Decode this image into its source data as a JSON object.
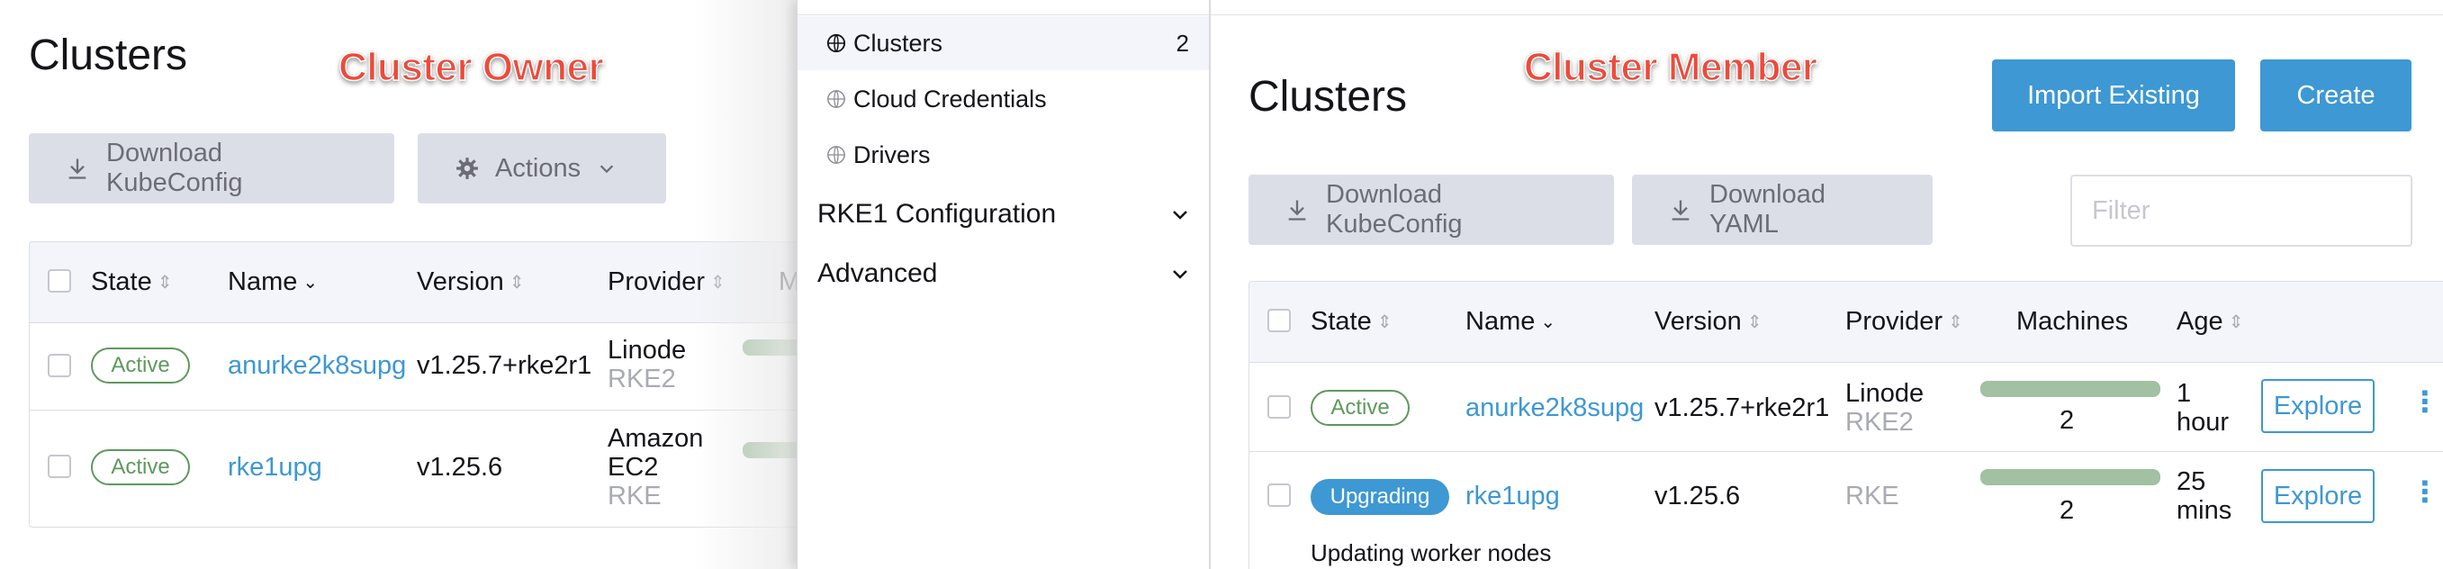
{
  "owner": {
    "title": "Clusters",
    "callout": "Cluster Owner",
    "download_kubeconfig": "Download KubeConfig",
    "actions": "Actions",
    "columns": [
      "State",
      "Name",
      "Version",
      "Provider",
      "M"
    ],
    "rows": [
      {
        "state": "Active",
        "name": "anurke2k8supg",
        "version": "v1.25.7+rke2r1",
        "provider": "Linode",
        "provider_sub": "RKE2"
      },
      {
        "state": "Active",
        "name": "rke1upg",
        "version": "v1.25.6",
        "provider": "Amazon",
        "provider_line2": "EC2",
        "provider_sub": "RKE"
      }
    ]
  },
  "nav": {
    "items": [
      {
        "label": "Clusters",
        "count": "2",
        "icon": "globe-icon"
      },
      {
        "label": "Cloud Credentials",
        "icon": "globe-icon"
      },
      {
        "label": "Drivers",
        "icon": "globe-icon"
      }
    ],
    "groups": [
      {
        "label": "RKE1 Configuration"
      },
      {
        "label": "Advanced"
      }
    ]
  },
  "member": {
    "title": "Clusters",
    "callout": "Cluster Member",
    "import_existing": "Import Existing",
    "create": "Create",
    "download_kubeconfig": "Download KubeConfig",
    "download_yaml": "Download YAML",
    "filter_placeholder": "Filter",
    "columns": [
      "State",
      "Name",
      "Version",
      "Provider",
      "Machines",
      "Age"
    ],
    "rows": [
      {
        "state": "Active",
        "name": "anurke2k8supg",
        "version": "v1.25.7+rke2r1",
        "provider": "Linode",
        "provider_sub": "RKE2",
        "machines": "2",
        "age_1": "1",
        "age_2": "hour",
        "explore": "Explore"
      },
      {
        "state": "Upgrading",
        "name": "rke1upg",
        "version": "v1.25.6",
        "provider_sub": "RKE",
        "machines": "2",
        "age_1": "25",
        "age_2": "mins",
        "explore": "Explore",
        "sub_status": "Updating worker nodes"
      }
    ]
  },
  "colors": {
    "accent": "#3d98d3",
    "active": "#5d995d",
    "callout": "#ef4a3a",
    "machine_bar": "#a2c0a2"
  }
}
